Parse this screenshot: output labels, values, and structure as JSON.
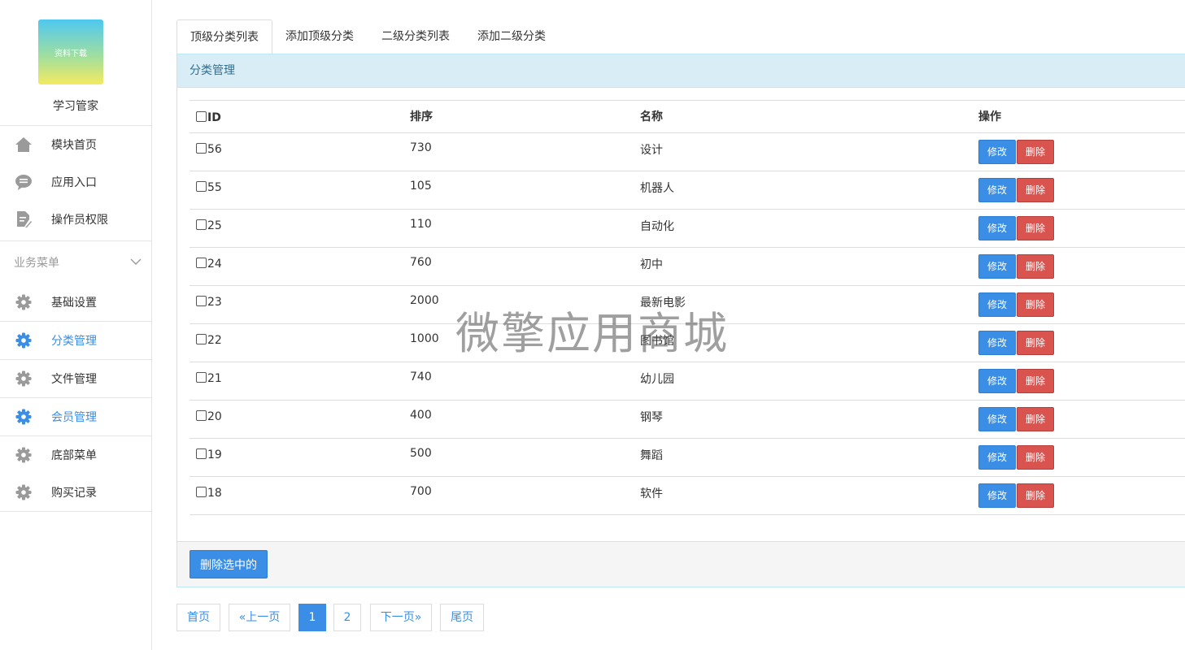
{
  "sidebar": {
    "logo_text": "资料下载",
    "brand_name": "学习管家",
    "top_items": [
      {
        "label": "模块首页",
        "icon": "home-icon"
      },
      {
        "label": "应用入口",
        "icon": "chat-bubble-icon"
      },
      {
        "label": "操作员权限",
        "icon": "document-edit-icon"
      }
    ],
    "section_title": "业务菜单",
    "menu_items": [
      {
        "label": "基础设置",
        "icon": "gear-icon",
        "active": false
      },
      {
        "label": "分类管理",
        "icon": "gear-icon",
        "active": true
      },
      {
        "label": "文件管理",
        "icon": "gear-icon",
        "active": false
      },
      {
        "label": "会员管理",
        "icon": "gear-icon",
        "active": true
      },
      {
        "label": "底部菜单",
        "icon": "gear-icon",
        "active": false
      },
      {
        "label": "购买记录",
        "icon": "gear-icon",
        "active": false
      }
    ]
  },
  "tabs": [
    "顶级分类列表",
    "添加顶级分类",
    "二级分类列表",
    "添加二级分类"
  ],
  "panel": {
    "title": "分类管理",
    "columns": {
      "id": "ID",
      "sort": "排序",
      "name": "名称",
      "ops": "操作"
    },
    "rows": [
      {
        "id": "56",
        "sort": "730",
        "name": "设计"
      },
      {
        "id": "55",
        "sort": "105",
        "name": "机器人"
      },
      {
        "id": "25",
        "sort": "110",
        "name": "自动化"
      },
      {
        "id": "24",
        "sort": "760",
        "name": "初中"
      },
      {
        "id": "23",
        "sort": "2000",
        "name": "最新电影"
      },
      {
        "id": "22",
        "sort": "1000",
        "name": "图书馆"
      },
      {
        "id": "21",
        "sort": "740",
        "name": "幼儿园"
      },
      {
        "id": "20",
        "sort": "400",
        "name": "钢琴"
      },
      {
        "id": "19",
        "sort": "500",
        "name": "舞蹈"
      },
      {
        "id": "18",
        "sort": "700",
        "name": "软件"
      }
    ],
    "edit_label": "修改",
    "delete_label": "删除",
    "delete_selected_label": "删除选中的"
  },
  "pagination": {
    "first": "首页",
    "prev": "«上一页",
    "pages": [
      "1",
      "2"
    ],
    "current": "1",
    "next": "下一页»",
    "last": "尾页"
  },
  "watermark": "微擎应用商城",
  "colors": {
    "accent": "#3a8ee6",
    "danger": "#d9534f",
    "panel_header_bg": "#d9edf7",
    "panel_header_text": "#31708f"
  }
}
